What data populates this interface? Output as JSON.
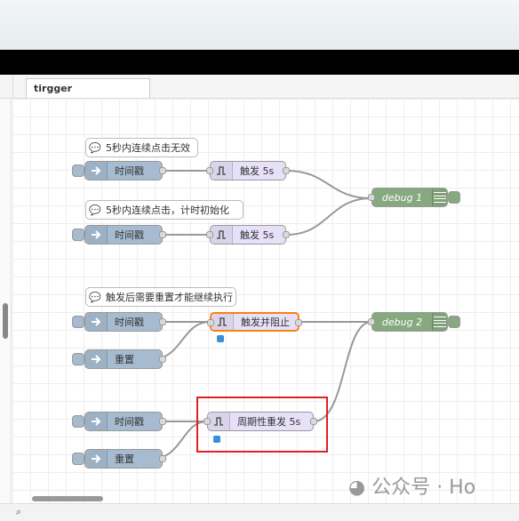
{
  "tab": {
    "label": "tirgger"
  },
  "comments": [
    "5秒内连续点击无效",
    "5秒内连续点击，计时初始化",
    "触发后需要重置才能继续执行"
  ],
  "inject_nodes": [
    "时间戳",
    "时间戳",
    "时间戳",
    "重置",
    "时间戳",
    "重置"
  ],
  "trigger_nodes": [
    "触发 5s",
    "触发 5s",
    "触发并阻止",
    "周期性重发 5s"
  ],
  "debug_nodes": [
    "debug 1",
    "debug 2"
  ],
  "watermark": {
    "text": "公众号 · Ho"
  },
  "footer": {
    "zoom_icon": "search-icon"
  },
  "colors": {
    "inject": "#a6bbcf",
    "trigger": "#e6e0f8",
    "debug": "#87a980",
    "highlight": "#e02020",
    "selected": "#ff7f0e"
  }
}
